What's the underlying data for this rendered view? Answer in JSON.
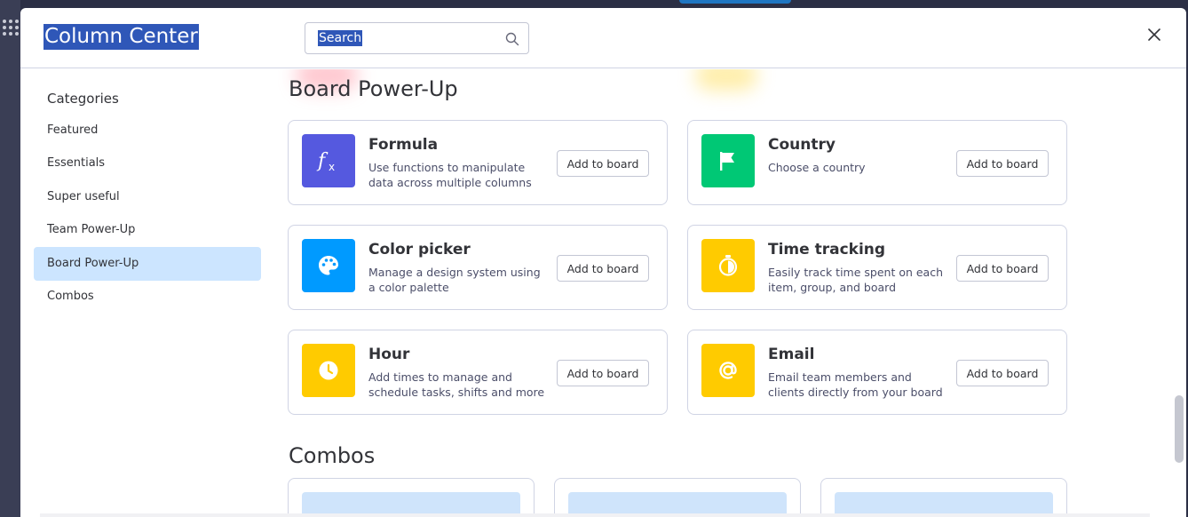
{
  "modal": {
    "title": "Column Center",
    "search": {
      "value": "Search",
      "placeholder": "Search"
    }
  },
  "sidebar": {
    "heading": "Categories",
    "items": [
      {
        "label": "Featured"
      },
      {
        "label": "Essentials"
      },
      {
        "label": "Super useful"
      },
      {
        "label": "Team Power-Up"
      },
      {
        "label": "Board Power-Up",
        "active": true
      },
      {
        "label": "Combos"
      }
    ]
  },
  "main": {
    "section_board_powerup": "Board Power-Up",
    "section_combos": "Combos",
    "add_button_label": "Add to board",
    "columns": [
      {
        "title": "Formula",
        "description": "Use functions to manipulate data across multiple columns",
        "icon": "formula-icon",
        "color": "#5559df"
      },
      {
        "title": "Country",
        "description": "Choose a country",
        "icon": "flag-icon",
        "color": "#00c875"
      },
      {
        "title": "Color picker",
        "description": "Manage a design system using a color palette",
        "icon": "palette-icon",
        "color": "#009aff"
      },
      {
        "title": "Time tracking",
        "description": "Easily track time spent on each item, group, and board",
        "icon": "stopwatch-icon",
        "color": "#ffcb00"
      },
      {
        "title": "Hour",
        "description": "Add times to manage and schedule tasks, shifts and more",
        "icon": "clock-icon",
        "color": "#ffcb00"
      },
      {
        "title": "Email",
        "description": "Email team members and clients directly from your board",
        "icon": "at-sign-icon",
        "color": "#ffcb00"
      }
    ]
  },
  "colors": {
    "selection": "#2f57b8",
    "active_category": "#cce5ff",
    "combo_preview": "#cfe4fb"
  }
}
